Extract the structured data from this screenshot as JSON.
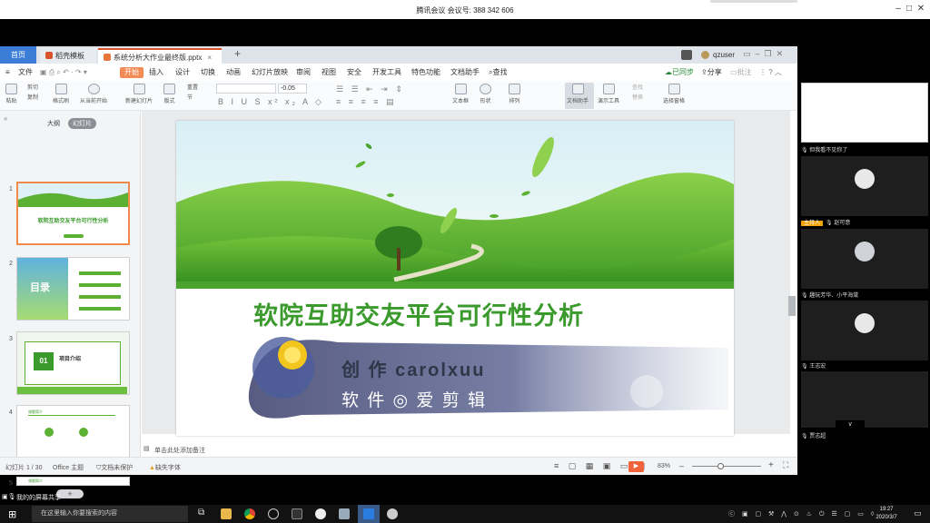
{
  "meeting": {
    "title": "腾讯会议 会议号: 388 342 606"
  },
  "app": {
    "tabs": [
      "首页",
      "稻壳模板",
      "系统分析大作业最终版.pptx"
    ],
    "user": "qzuser",
    "menu": [
      "文件",
      "开始",
      "插入",
      "设计",
      "切换",
      "动画",
      "幻灯片放映",
      "审阅",
      "视图",
      "安全",
      "开发工具",
      "特色功能",
      "文档助手",
      "查找"
    ],
    "menu_right": [
      "已同步",
      "分享",
      "批注"
    ],
    "ribbon": {
      "groups": [
        "粘贴",
        "剪切",
        "复制",
        "格式刷",
        "从当前开始",
        "新建幻灯片",
        "版式",
        "重置",
        "节"
      ],
      "font_size": "-0.05",
      "right": [
        "文本框",
        "形状",
        "排列",
        "文档助手",
        "演示工具",
        "选择窗格",
        "查找",
        "替换"
      ]
    },
    "panel_tabs": [
      "大纲",
      "幻灯片"
    ],
    "slides": [
      {
        "num": "1",
        "title": "软院互助交友平台可行性分析"
      },
      {
        "num": "2",
        "title": "目录"
      },
      {
        "num": "3",
        "title": "项目介绍",
        "badge": "01"
      },
      {
        "num": "4",
        "title": "课题简介"
      },
      {
        "num": "5",
        "title": "课题简介"
      }
    ],
    "slide": {
      "title": "软院互助交友平台可行性分析",
      "credit_line1": "创 作 carolxuu",
      "credit_line2": "软 件 ◎ 爱 剪 辑"
    },
    "notes_placeholder": "单击此处添加备注",
    "status": {
      "slide_indicator": "幻灯片 1 / 30",
      "theme": "Office 主题",
      "protect": "文档未保护",
      "missing_font": "缺失字体",
      "zoom": "83%"
    }
  },
  "participants": [
    {
      "name": "但我看不见你了"
    },
    {
      "name": "赵可意",
      "badge": "主持人"
    },
    {
      "name": "趣玩芳华、小平海棠"
    },
    {
      "name": "王志宏"
    },
    {
      "name": "贾志超"
    }
  ],
  "sharing_notice": "我的的屏幕共享",
  "taskbar": {
    "search_placeholder": "在这里输入你要搜索的内容",
    "time": "19:27",
    "date": "2020/3/7"
  },
  "colors": {
    "accent_orange": "#f28b54",
    "accent_blue": "#3c7dd8",
    "slide_green": "#3a9a2c"
  }
}
